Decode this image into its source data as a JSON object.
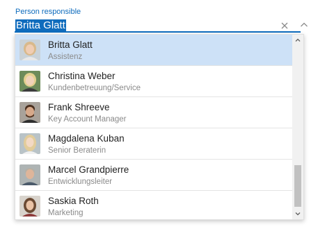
{
  "field": {
    "label": "Person responsible",
    "value": "Britta Glatt",
    "clear_icon": "close-icon",
    "collapse_icon": "chevron-up-icon"
  },
  "colors": {
    "accent": "#0f6cbd",
    "selected_row": "#cde1f7"
  },
  "options": [
    {
      "name": "Britta Glatt",
      "role": "Assistenz",
      "selected": true,
      "icon": "avatar-photo"
    },
    {
      "name": "Christina Weber",
      "role": "Kundenbetreuung/Service",
      "selected": false,
      "icon": "avatar-photo"
    },
    {
      "name": "Frank Shreeve",
      "role": "Key Account Manager",
      "selected": false,
      "icon": "avatar-photo"
    },
    {
      "name": "Magdalena Kuban",
      "role": "Senior Beraterin",
      "selected": false,
      "icon": "avatar-photo"
    },
    {
      "name": "Marcel Grandpierre",
      "role": "Entwicklungsleiter",
      "selected": false,
      "icon": "avatar-photo"
    },
    {
      "name": "Saskia Roth",
      "role": "Marketing",
      "selected": false,
      "icon": "avatar-photo"
    }
  ],
  "scrollbar": {
    "position_fraction": 0.92
  }
}
